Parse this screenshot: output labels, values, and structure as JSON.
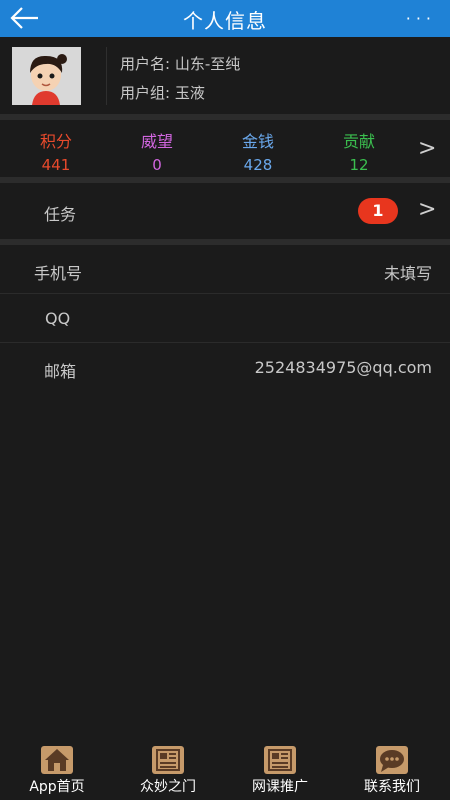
{
  "header": {
    "title": "个人信息",
    "more_label": "···",
    "colors": {
      "bar": "#1f82d6"
    }
  },
  "profile": {
    "username_line": "用户名: 山东-至纯",
    "usergroup_line": "用户组: 玉液"
  },
  "stats": [
    {
      "name": "积分",
      "value": "441",
      "color": "#e84a2c"
    },
    {
      "name": "威望",
      "value": "0",
      "color": "#d266e0"
    },
    {
      "name": "金钱",
      "value": "428",
      "color": "#6aa8ec"
    },
    {
      "name": "贡献",
      "value": "12",
      "color": "#3bbf4f"
    }
  ],
  "chevron": ">",
  "task": {
    "label": "任务",
    "badge": "1"
  },
  "fields": [
    {
      "label": "手机号",
      "value": "未填写"
    },
    {
      "label": "QQ",
      "value": ""
    },
    {
      "label": "邮箱",
      "value": "2524834975@qq.com"
    }
  ],
  "tabbar": [
    {
      "label": "App首页",
      "icon": "home-icon"
    },
    {
      "label": "众妙之门",
      "icon": "news-icon"
    },
    {
      "label": "网课推广",
      "icon": "news-icon"
    },
    {
      "label": "联系我们",
      "icon": "chat-icon"
    }
  ]
}
